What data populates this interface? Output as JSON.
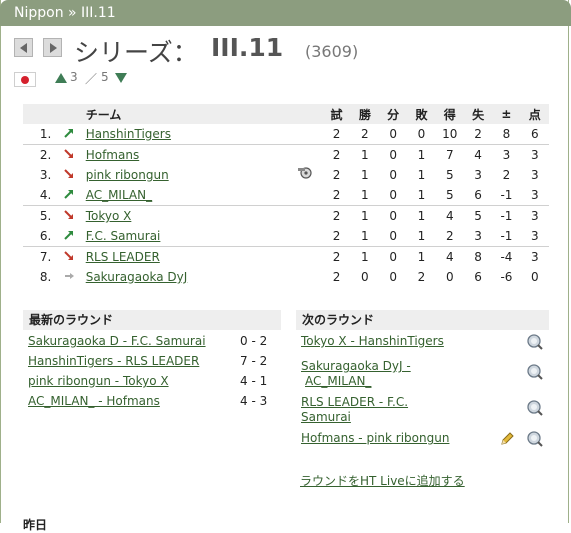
{
  "breadcrumb": "Nippon » III.11",
  "title": {
    "series_label": "シリーズ：",
    "league": "III.11",
    "count": "(3609)"
  },
  "rank": {
    "current": "3",
    "separator": "／",
    "total": "5"
  },
  "table": {
    "headers": [
      "チーム",
      "試",
      "勝",
      "分",
      "敗",
      "得",
      "失",
      "±",
      "点"
    ],
    "rows": [
      {
        "pos": "1.",
        "trend": "up",
        "team": "HanshinTigers",
        "icon": "",
        "g": "2",
        "w": "2",
        "d": "0",
        "l": "0",
        "gf": "10",
        "ga": "2",
        "diff": "8",
        "pts": "6"
      },
      {
        "pos": "2.",
        "trend": "down",
        "team": "Hofmans",
        "icon": "",
        "g": "2",
        "w": "1",
        "d": "0",
        "l": "1",
        "gf": "7",
        "ga": "4",
        "diff": "3",
        "pts": "3"
      },
      {
        "pos": "3.",
        "trend": "down",
        "team": "pink ribongun",
        "icon": "whistle-icon",
        "g": "2",
        "w": "1",
        "d": "0",
        "l": "1",
        "gf": "5",
        "ga": "3",
        "diff": "2",
        "pts": "3"
      },
      {
        "pos": "4.",
        "trend": "up",
        "team": "AC_MILAN_",
        "icon": "",
        "g": "2",
        "w": "1",
        "d": "0",
        "l": "1",
        "gf": "5",
        "ga": "6",
        "diff": "-1",
        "pts": "3"
      },
      {
        "pos": "5.",
        "trend": "down",
        "team": "Tokyo X",
        "icon": "",
        "g": "2",
        "w": "1",
        "d": "0",
        "l": "1",
        "gf": "4",
        "ga": "5",
        "diff": "-1",
        "pts": "3"
      },
      {
        "pos": "6.",
        "trend": "up",
        "team": "F.C. Samurai",
        "icon": "",
        "g": "2",
        "w": "1",
        "d": "0",
        "l": "1",
        "gf": "2",
        "ga": "3",
        "diff": "-1",
        "pts": "3"
      },
      {
        "pos": "7.",
        "trend": "down",
        "team": "RLS LEADER",
        "icon": "",
        "g": "2",
        "w": "1",
        "d": "0",
        "l": "1",
        "gf": "4",
        "ga": "8",
        "diff": "-4",
        "pts": "3"
      },
      {
        "pos": "8.",
        "trend": "same",
        "team": "Sakuragaoka DyJ",
        "icon": "",
        "g": "2",
        "w": "0",
        "d": "0",
        "l": "2",
        "gf": "0",
        "ga": "6",
        "diff": "-6",
        "pts": "0"
      }
    ]
  },
  "latest": {
    "heading": "最新のラウンド",
    "matches": [
      {
        "match": "Sakuragaoka D - F.C. Samurai",
        "score": "0 - 2"
      },
      {
        "match": "HanshinTigers - RLS LEADER",
        "score": "7 - 2"
      },
      {
        "match": "pink ribongun - Tokyo X",
        "score": "4 - 1"
      },
      {
        "match": "AC_MILAN_ - Hofmans",
        "score": "4 - 3"
      }
    ]
  },
  "next": {
    "heading": "次のラウンド",
    "matches": [
      {
        "line1": "Tokyo X - HanshinTigers",
        "line2": ""
      },
      {
        "line1": "Sakuragaoka DyJ -",
        "line2": "AC_MILAN_"
      },
      {
        "line1": "RLS LEADER - F.C.",
        "line2": "Samurai"
      },
      {
        "line1": "Hofmans - pink ribongun",
        "line2": ""
      }
    ],
    "add_live": "ラウンドをHT Liveに追加する"
  },
  "footer_cut": "昨日"
}
